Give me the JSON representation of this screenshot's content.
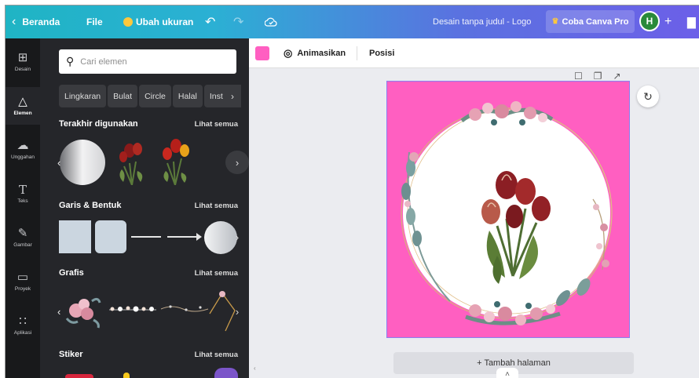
{
  "topbar": {
    "back_label": "Beranda",
    "file_label": "File",
    "resize_label": "Ubah ukuran",
    "doc_title": "Desain tanpa judul - Logo",
    "pro_label": "Coba Canva Pro",
    "avatar_initial": "H",
    "plus": "+"
  },
  "rail": {
    "items": [
      {
        "label": "Desain",
        "icon": "layout-icon"
      },
      {
        "label": "Elemen",
        "icon": "shapes-icon"
      },
      {
        "label": "Unggahan",
        "icon": "upload-icon"
      },
      {
        "label": "Teks",
        "icon": "text-icon"
      },
      {
        "label": "Gambar",
        "icon": "draw-icon"
      },
      {
        "label": "Proyek",
        "icon": "folder-icon"
      },
      {
        "label": "Aplikasi",
        "icon": "apps-icon"
      }
    ]
  },
  "panel": {
    "search_placeholder": "Cari elemen",
    "chips": [
      "Lingkaran",
      "Bulat",
      "Circle",
      "Halal",
      "Inst"
    ],
    "see_all": "Lihat semua",
    "sections": [
      {
        "title": "Terakhir digunakan"
      },
      {
        "title": "Garis & Bentuk"
      },
      {
        "title": "Grafis"
      },
      {
        "title": "Stiker"
      }
    ]
  },
  "toolbar": {
    "color": "#ff5fc1",
    "animate_label": "Animasikan",
    "position_label": "Posisi"
  },
  "canvas": {
    "background": "#ff5fc1",
    "add_page_label": "+ Tambah halaman"
  }
}
